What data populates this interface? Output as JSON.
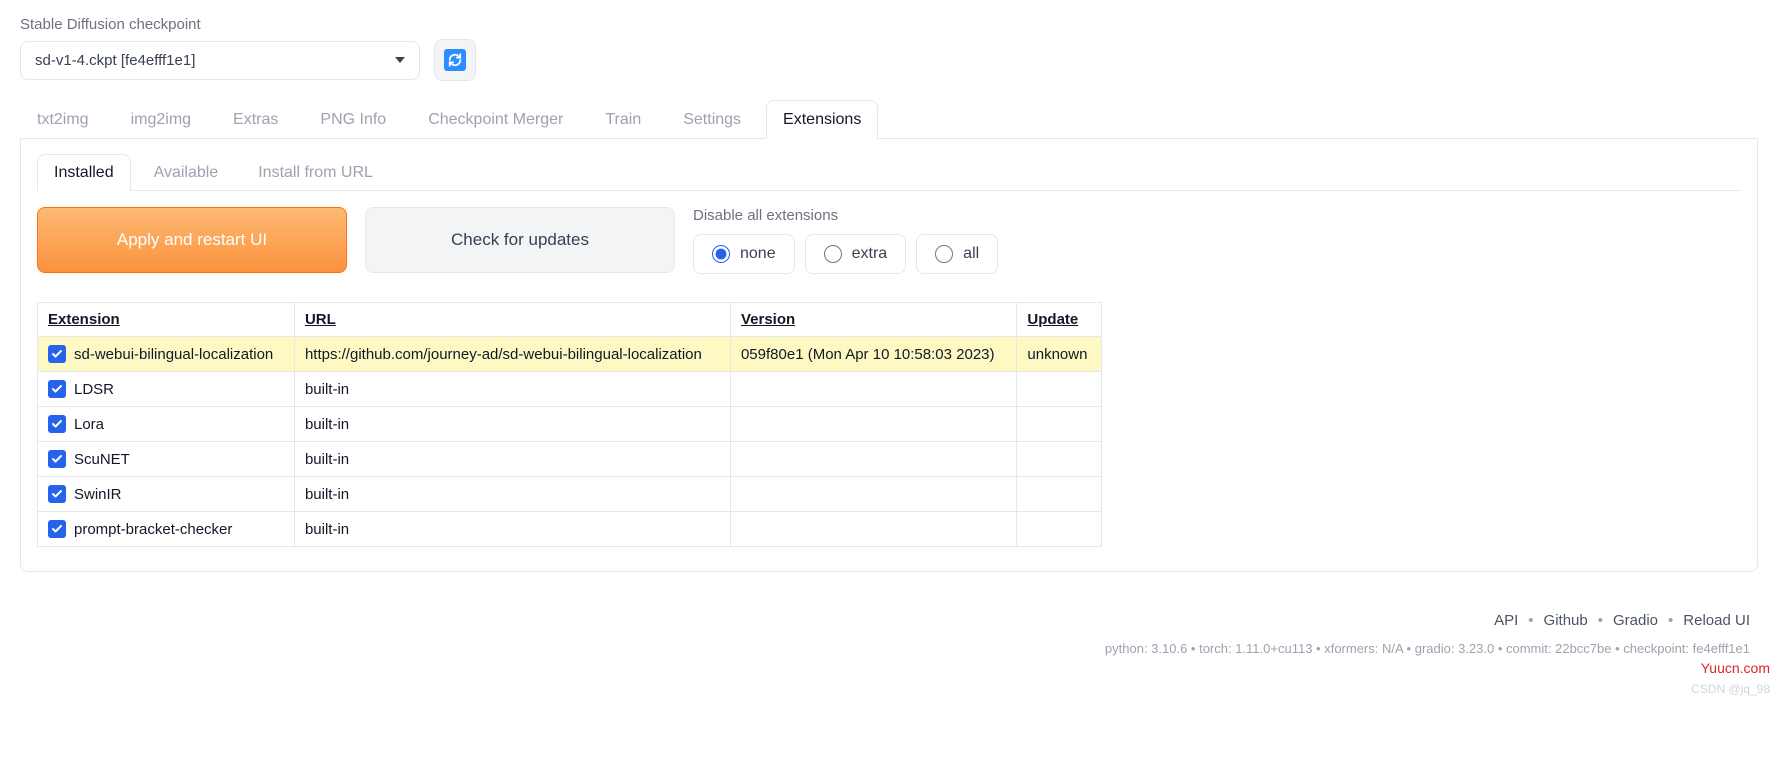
{
  "top": {
    "label": "Stable Diffusion checkpoint",
    "selected": "sd-v1-4.ckpt [fe4efff1e1]"
  },
  "mainTabs": [
    "txt2img",
    "img2img",
    "Extras",
    "PNG Info",
    "Checkpoint Merger",
    "Train",
    "Settings",
    "Extensions"
  ],
  "mainActive": 7,
  "subTabs": [
    "Installed",
    "Available",
    "Install from URL"
  ],
  "subActive": 0,
  "buttons": {
    "apply": "Apply and restart UI",
    "check": "Check for updates"
  },
  "disable": {
    "label": "Disable all extensions",
    "options": [
      "none",
      "extra",
      "all"
    ],
    "selected": "none"
  },
  "tableHeaders": [
    "Extension",
    "URL",
    "Version",
    "Update"
  ],
  "rows": [
    {
      "name": "sd-webui-bilingual-localization",
      "url": "https://github.com/journey-ad/sd-webui-bilingual-localization",
      "version": "059f80e1 (Mon Apr 10 10:58:03 2023)",
      "update": "unknown",
      "highlight": true
    },
    {
      "name": "LDSR",
      "url": "built-in",
      "version": "",
      "update": "",
      "highlight": false
    },
    {
      "name": "Lora",
      "url": "built-in",
      "version": "",
      "update": "",
      "highlight": false
    },
    {
      "name": "ScuNET",
      "url": "built-in",
      "version": "",
      "update": "",
      "highlight": false
    },
    {
      "name": "SwinIR",
      "url": "built-in",
      "version": "",
      "update": "",
      "highlight": false
    },
    {
      "name": "prompt-bracket-checker",
      "url": "built-in",
      "version": "",
      "update": "",
      "highlight": false
    }
  ],
  "footerLinks": [
    "API",
    "Github",
    "Gradio",
    "Reload UI"
  ],
  "footerInfo": "python: 3.10.6  •  torch: 1.11.0+cu113  •  xformers: N/A  •  gradio: 3.23.0  •  commit: 22bcc7be  •  checkpoint: fe4efff1e1",
  "watermark1": "Yuucn.com",
  "watermark2": "CSDN @jq_98"
}
